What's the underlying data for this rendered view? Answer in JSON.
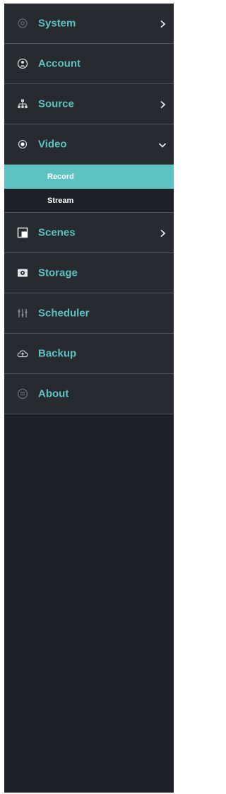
{
  "colors": {
    "accent": "#5ec2c2",
    "item_bg": "#272b2f",
    "sidebar_bg": "#1d2024",
    "divider": "#4d5256"
  },
  "menu": [
    {
      "label": "System",
      "icon": "gear-icon",
      "chevron": "right"
    },
    {
      "label": "Account",
      "icon": "user-icon"
    },
    {
      "label": "Source",
      "icon": "sitemap-icon",
      "chevron": "right"
    },
    {
      "label": "Video",
      "icon": "record-dot-icon",
      "chevron": "down",
      "expanded": true,
      "children": [
        {
          "label": "Record",
          "active": true
        },
        {
          "label": "Stream",
          "active": false
        }
      ]
    },
    {
      "label": "Scenes",
      "icon": "scenes-icon",
      "chevron": "right"
    },
    {
      "label": "Storage",
      "icon": "storage-icon"
    },
    {
      "label": "Scheduler",
      "icon": "scheduler-icon"
    },
    {
      "label": "Backup",
      "icon": "cloud-icon"
    },
    {
      "label": "About",
      "icon": "info-icon"
    }
  ]
}
